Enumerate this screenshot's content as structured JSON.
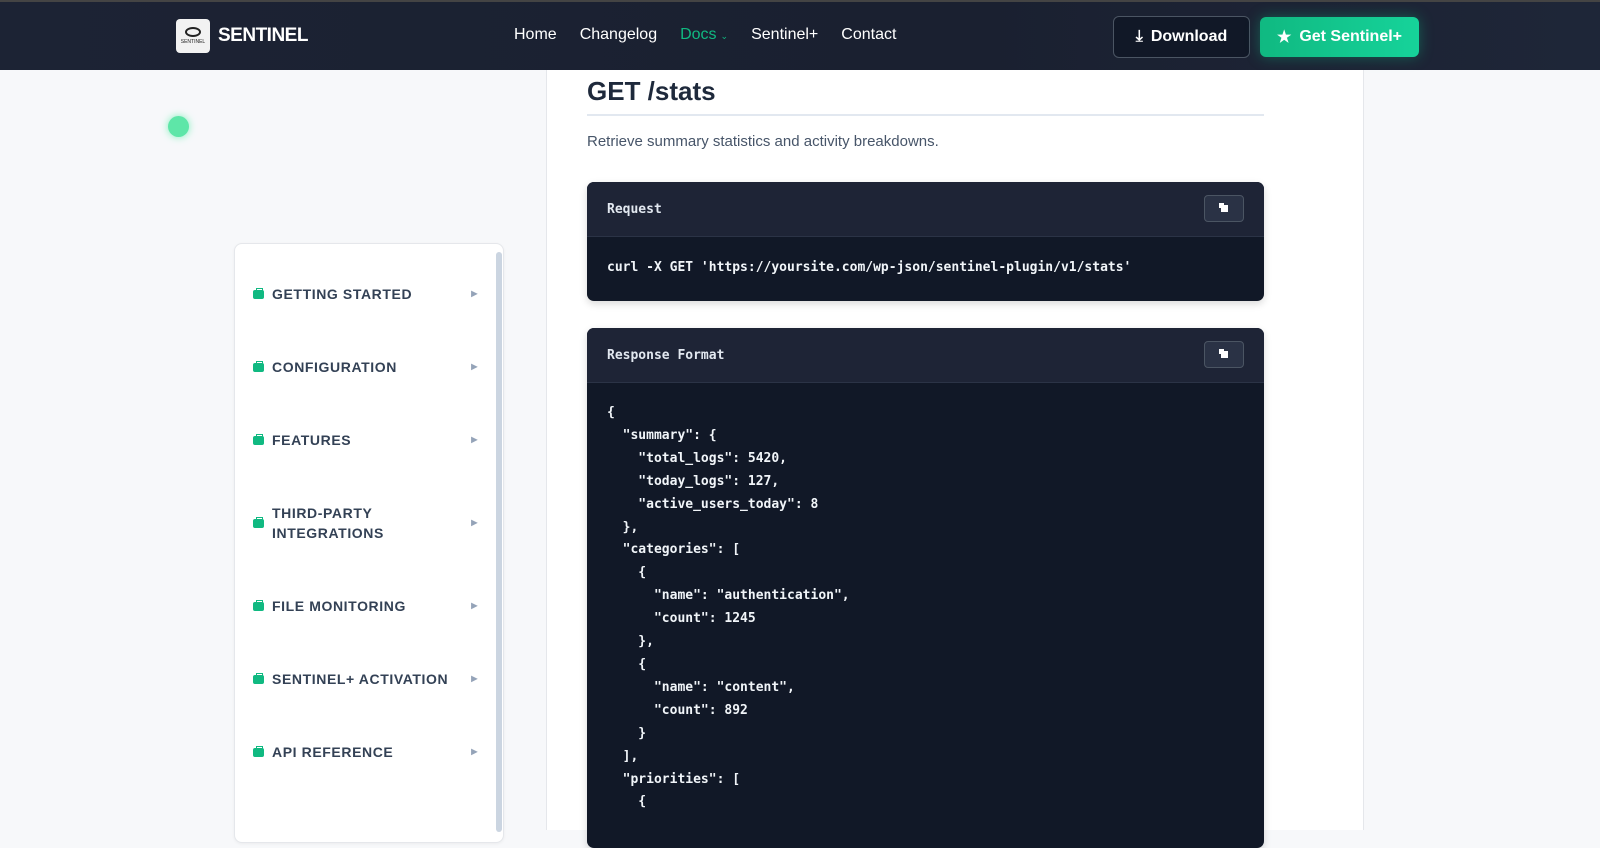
{
  "header": {
    "logo_text": "SENTINEL",
    "logo_badge": "SENTINEL",
    "nav": [
      {
        "label": "Home"
      },
      {
        "label": "Changelog"
      },
      {
        "label": "Docs",
        "active": true
      },
      {
        "label": "Sentinel+"
      },
      {
        "label": "Contact"
      }
    ],
    "download_label": "Download",
    "get_label": "Get Sentinel+"
  },
  "colors": {
    "accent": "#10b981",
    "header_bg": "#1c2334",
    "code_bg": "#111827"
  },
  "sidebar": {
    "items": [
      {
        "label": "GETTING STARTED"
      },
      {
        "label": "CONFIGURATION"
      },
      {
        "label": "FEATURES"
      },
      {
        "label": "THIRD-PARTY INTEGRATIONS"
      },
      {
        "label": "FILE MONITORING"
      },
      {
        "label": "SENTINEL+ ACTIVATION"
      },
      {
        "label": "API REFERENCE"
      }
    ]
  },
  "main": {
    "title": "GET /stats",
    "description": "Retrieve summary statistics and activity breakdowns.",
    "request": {
      "label": "Request",
      "code": "curl -X GET 'https://yoursite.com/wp-json/sentinel-plugin/v1/stats'"
    },
    "response": {
      "label": "Response Format",
      "code": "{\n  \"summary\": {\n    \"total_logs\": 5420,\n    \"today_logs\": 127,\n    \"active_users_today\": 8\n  },\n  \"categories\": [\n    {\n      \"name\": \"authentication\",\n      \"count\": 1245\n    },\n    {\n      \"name\": \"content\",\n      \"count\": 892\n    }\n  ],\n  \"priorities\": [\n    {"
    }
  }
}
